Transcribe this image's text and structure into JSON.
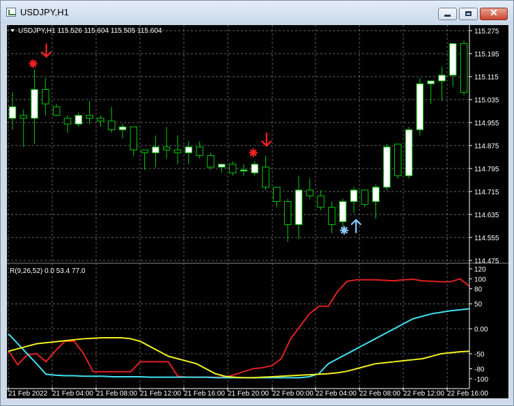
{
  "window": {
    "title": "USDJPY,H1",
    "icon": "chart-window-icon",
    "controls": {
      "minimize": "minimize-icon",
      "maximize": "maximize-icon",
      "close": "close-icon"
    }
  },
  "chart": {
    "header_label": "USDJPY,H1  115.526 115.604 115.505 115.604",
    "indicator_label": "R(9,26,52) 0.0 53.4 77.0",
    "colors": {
      "background": "#000000",
      "bull_candle": "#ffffff",
      "bear_candle": "#000000",
      "wick": "#00cc00",
      "sell_signal": "#ff2222",
      "buy_signal": "#88ccff",
      "line_fast": "#e02020",
      "line_mid": "#40e0f0",
      "line_slow": "#f0f020",
      "grid": "#8a8a8a"
    }
  },
  "chart_data": [
    {
      "type": "candlestick",
      "symbol": "USDJPY",
      "timeframe": "H1",
      "ylim": [
        114.475,
        115.275
      ],
      "yticks": [
        "115.275",
        "115.195",
        "115.115",
        "115.035",
        "114.955",
        "114.875",
        "114.795",
        "114.715",
        "114.635",
        "114.555",
        "114.475"
      ],
      "xticks": [
        "21 Feb 2022",
        "21 Feb 04:00",
        "21 Feb 08:00",
        "21 Feb 12:00",
        "21 Feb 16:00",
        "21 Feb 20:00",
        "22 Feb 00:00",
        "22 Feb 04:00",
        "22 Feb 08:00",
        "22 Feb 12:00",
        "22 Feb 16:00"
      ],
      "candles": [
        {
          "o": 114.97,
          "h": 115.06,
          "l": 114.93,
          "c": 115.01
        },
        {
          "o": 114.98,
          "h": 115.0,
          "l": 114.87,
          "c": 114.97
        },
        {
          "o": 114.97,
          "h": 115.14,
          "l": 114.88,
          "c": 115.07
        },
        {
          "o": 115.07,
          "h": 115.11,
          "l": 114.98,
          "c": 115.02
        },
        {
          "o": 115.01,
          "h": 115.02,
          "l": 114.98,
          "c": 114.98
        },
        {
          "o": 114.97,
          "h": 114.98,
          "l": 114.92,
          "c": 114.95
        },
        {
          "o": 114.95,
          "h": 114.99,
          "l": 114.94,
          "c": 114.98
        },
        {
          "o": 114.98,
          "h": 115.03,
          "l": 114.95,
          "c": 114.97
        },
        {
          "o": 114.97,
          "h": 114.98,
          "l": 114.94,
          "c": 114.96
        },
        {
          "o": 114.96,
          "h": 115.01,
          "l": 114.92,
          "c": 114.93
        },
        {
          "o": 114.93,
          "h": 114.95,
          "l": 114.9,
          "c": 114.94
        },
        {
          "o": 114.94,
          "h": 114.94,
          "l": 114.84,
          "c": 114.86
        },
        {
          "o": 114.86,
          "h": 114.86,
          "l": 114.79,
          "c": 114.85
        },
        {
          "o": 114.85,
          "h": 114.91,
          "l": 114.8,
          "c": 114.87
        },
        {
          "o": 114.87,
          "h": 114.94,
          "l": 114.83,
          "c": 114.86
        },
        {
          "o": 114.86,
          "h": 114.91,
          "l": 114.81,
          "c": 114.85
        },
        {
          "o": 114.85,
          "h": 114.89,
          "l": 114.81,
          "c": 114.87
        },
        {
          "o": 114.87,
          "h": 114.89,
          "l": 114.83,
          "c": 114.84
        },
        {
          "o": 114.84,
          "h": 114.85,
          "l": 114.79,
          "c": 114.8
        },
        {
          "o": 114.8,
          "h": 114.81,
          "l": 114.78,
          "c": 114.81
        },
        {
          "o": 114.81,
          "h": 114.82,
          "l": 114.77,
          "c": 114.78
        },
        {
          "o": 114.79,
          "h": 114.81,
          "l": 114.77,
          "c": 114.79
        },
        {
          "o": 114.78,
          "h": 114.82,
          "l": 114.77,
          "c": 114.81
        },
        {
          "o": 114.8,
          "h": 114.84,
          "l": 114.72,
          "c": 114.73
        },
        {
          "o": 114.73,
          "h": 114.73,
          "l": 114.66,
          "c": 114.68
        },
        {
          "o": 114.68,
          "h": 114.69,
          "l": 114.54,
          "c": 114.6
        },
        {
          "o": 114.6,
          "h": 114.77,
          "l": 114.55,
          "c": 114.72
        },
        {
          "o": 114.72,
          "h": 114.76,
          "l": 114.69,
          "c": 114.7
        },
        {
          "o": 114.7,
          "h": 114.72,
          "l": 114.65,
          "c": 114.66
        },
        {
          "o": 114.66,
          "h": 114.68,
          "l": 114.57,
          "c": 114.6
        },
        {
          "o": 114.61,
          "h": 114.69,
          "l": 114.59,
          "c": 114.68
        },
        {
          "o": 114.68,
          "h": 114.73,
          "l": 114.64,
          "c": 114.72
        },
        {
          "o": 114.72,
          "h": 114.72,
          "l": 114.66,
          "c": 114.67
        },
        {
          "o": 114.68,
          "h": 114.74,
          "l": 114.62,
          "c": 114.73
        },
        {
          "o": 114.73,
          "h": 114.88,
          "l": 114.72,
          "c": 114.87
        },
        {
          "o": 114.88,
          "h": 114.88,
          "l": 114.76,
          "c": 114.77
        },
        {
          "o": 114.77,
          "h": 114.94,
          "l": 114.76,
          "c": 114.93
        },
        {
          "o": 114.93,
          "h": 115.11,
          "l": 114.91,
          "c": 115.09
        },
        {
          "o": 115.09,
          "h": 115.1,
          "l": 115.02,
          "c": 115.1
        },
        {
          "o": 115.1,
          "h": 115.15,
          "l": 115.03,
          "c": 115.12
        },
        {
          "o": 115.12,
          "h": 115.23,
          "l": 115.08,
          "c": 115.23
        },
        {
          "o": 115.23,
          "h": 115.24,
          "l": 115.05,
          "c": 115.06
        }
      ],
      "signals": [
        {
          "index": 2,
          "type": "sell",
          "price": 115.16
        },
        {
          "index": 22,
          "type": "sell",
          "price": 114.85
        },
        {
          "index": 30,
          "type": "buy",
          "price": 114.58
        }
      ]
    },
    {
      "type": "line",
      "ylim": [
        -110,
        120
      ],
      "yticks": [
        "120",
        "100",
        "80",
        "50",
        "0.00",
        "-50",
        "-80",
        "-100"
      ],
      "series": [
        {
          "color": "#e02020",
          "values": [
            -44,
            -72,
            -52,
            -50,
            -66,
            -44,
            -25,
            -25,
            -50,
            -86,
            -86,
            -86,
            -86,
            -86,
            -66,
            -66,
            -66,
            -66,
            -95,
            -97,
            -97,
            -97,
            -97,
            -97,
            -92,
            -86,
            -80,
            -78,
            -74,
            -60,
            -20,
            5,
            30,
            45,
            45,
            75,
            95,
            98,
            98,
            98,
            97,
            96,
            98,
            99,
            96,
            95,
            94,
            94,
            100,
            85
          ]
        },
        {
          "color": "#40e0f0",
          "values": [
            -10,
            -30,
            -50,
            -70,
            -91,
            -93,
            -94,
            -94,
            -95,
            -95,
            -95,
            -96,
            -96,
            -96,
            -96,
            -97,
            -97,
            -97,
            -97,
            -97,
            -97,
            -97,
            -98,
            -98,
            -98,
            -98,
            -98,
            -98,
            -98,
            -98,
            -98,
            -98,
            -96,
            -90,
            -70,
            -60,
            -50,
            -40,
            -30,
            -20,
            -10,
            0,
            10,
            20,
            25,
            30,
            33,
            36,
            38,
            40
          ]
        },
        {
          "color": "#f0f020",
          "values": [
            -45,
            -40,
            -35,
            -30,
            -28,
            -26,
            -24,
            -22,
            -20,
            -19,
            -18,
            -18,
            -18,
            -20,
            -25,
            -35,
            -45,
            -55,
            -60,
            -65,
            -70,
            -80,
            -90,
            -95,
            -97,
            -98,
            -98,
            -97,
            -96,
            -95,
            -94,
            -93,
            -92,
            -91,
            -90,
            -88,
            -85,
            -80,
            -75,
            -70,
            -68,
            -66,
            -64,
            -62,
            -60,
            -55,
            -50,
            -48,
            -46,
            -45
          ]
        }
      ]
    }
  ]
}
